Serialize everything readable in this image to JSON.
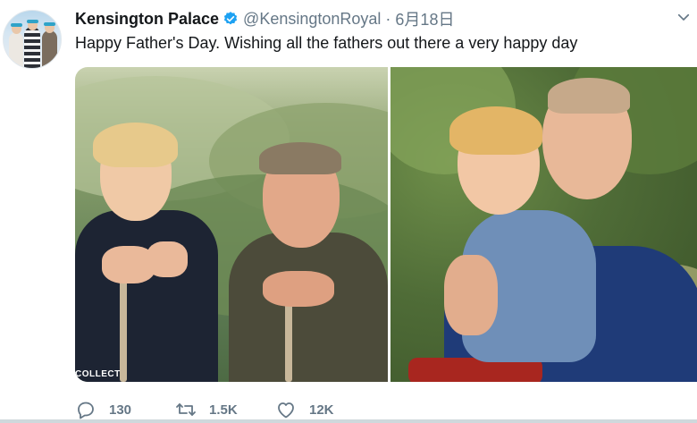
{
  "tweet": {
    "account_name": "Kensington Palace",
    "verified_icon": "verified-badge-icon",
    "handle": "@KensingtonRoyal",
    "separator": "·",
    "date": "6月18日",
    "text": "Happy Father's Day. Wishing all the fathers out there a very happy day",
    "media": {
      "watermark": "COLLECT"
    },
    "actions": {
      "reply": {
        "icon": "reply-icon",
        "count": "130"
      },
      "retweet": {
        "icon": "retweet-icon",
        "count": "1.5K"
      },
      "like": {
        "icon": "heart-icon",
        "count": "12K"
      }
    }
  },
  "colors": {
    "verified": "#1da1f2",
    "secondary_text": "#657786",
    "primary_text": "#14171a"
  }
}
